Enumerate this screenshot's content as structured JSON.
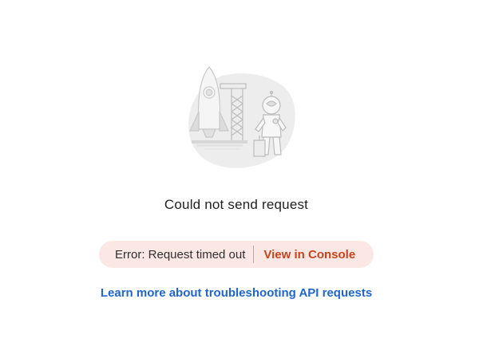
{
  "empty_state": {
    "title": "Could not send request"
  },
  "error": {
    "message": "Error: Request timed out",
    "console_link": "View in Console"
  },
  "help": {
    "link": "Learn more about troubleshooting API requests"
  },
  "colors": {
    "error_bg": "#fbe7e4",
    "console_link": "#c8441c",
    "help_link": "#1f66cf"
  },
  "illustration": {
    "icon": "rocket-astronaut-illustration"
  }
}
